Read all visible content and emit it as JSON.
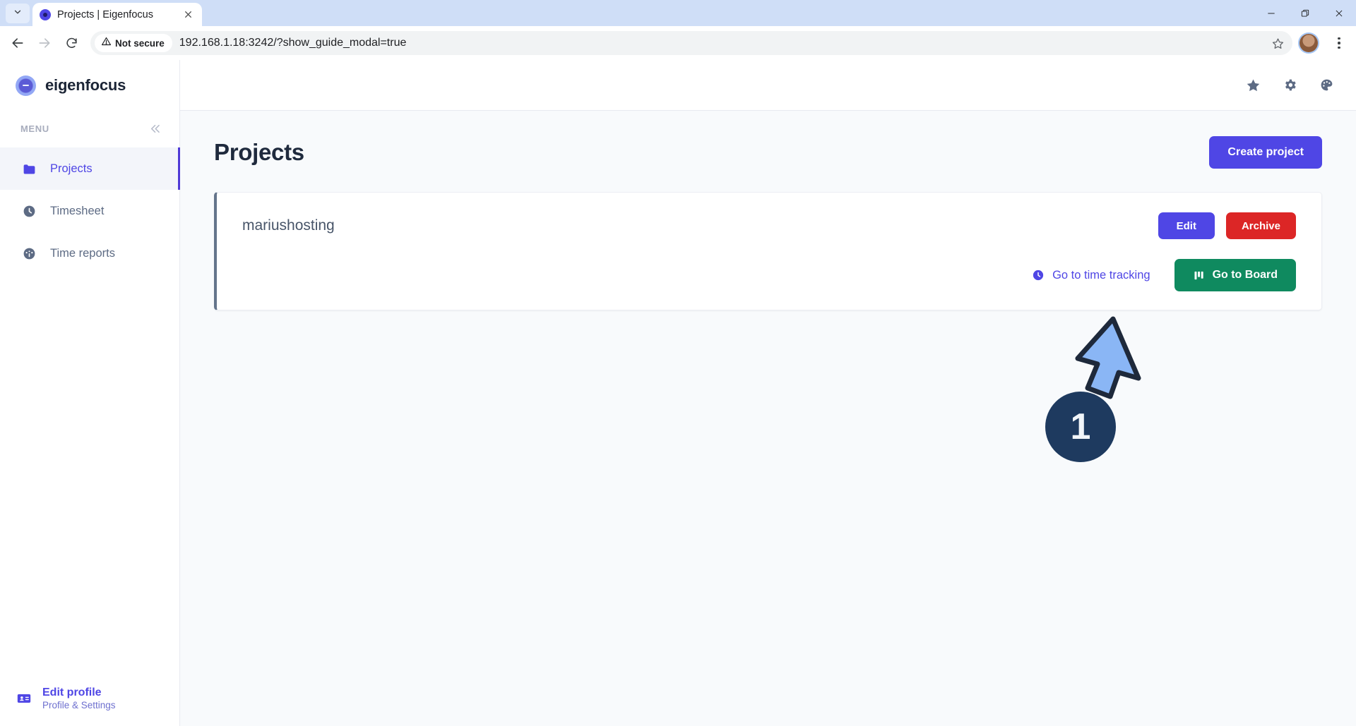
{
  "browser": {
    "tab": {
      "title": "Projects | Eigenfocus",
      "favicon": "circle-dot-icon",
      "close": "close-icon"
    },
    "tabstrip_dropdown_icon": "chevron-down-icon",
    "window_controls": {
      "minimize": "minimize-icon",
      "maximize": "restore-icon",
      "close": "close-icon"
    },
    "nav": {
      "back": "arrow-left-icon",
      "forward": "arrow-right-icon",
      "reload": "reload-icon"
    },
    "omnibox": {
      "security_icon": "warning-triangle-icon",
      "security_label": "Not secure",
      "url": "192.168.1.18:3242/?show_guide_modal=true",
      "bookmark_icon": "star-outline-icon"
    },
    "profile_avatar": "avatar",
    "menu_icon": "kebab-menu-icon"
  },
  "sidebar": {
    "brand": {
      "name": "eigenfocus",
      "logo_icon": "eigenfocus-logo-icon"
    },
    "menu_label": "MENU",
    "collapse_icon": "chevron-double-left-icon",
    "items": [
      {
        "label": "Projects",
        "icon": "folder-icon",
        "active": true
      },
      {
        "label": "Timesheet",
        "icon": "clock-icon",
        "active": false
      },
      {
        "label": "Time reports",
        "icon": "gauge-icon",
        "active": false
      }
    ],
    "footer": {
      "icon": "id-card-icon",
      "title": "Edit profile",
      "subtitle": "Profile & Settings"
    }
  },
  "topbar": {
    "icons": [
      {
        "name": "star-icon"
      },
      {
        "name": "gear-icon"
      },
      {
        "name": "palette-icon"
      }
    ]
  },
  "main": {
    "page_title": "Projects",
    "create_button": "Create project",
    "projects": [
      {
        "name": "mariushosting",
        "edit_label": "Edit",
        "archive_label": "Archive",
        "time_tracking_label": "Go to time tracking",
        "time_tracking_icon": "clock-icon",
        "board_label": "Go to Board",
        "board_icon": "kanban-columns-icon",
        "accent_color": "#64748b"
      }
    ]
  },
  "annotation": {
    "step_number": "1",
    "arrow_icon": "arrow-up-right-icon",
    "badge_color": "#1e3a5f",
    "arrow_fill": "#8ab6f5",
    "arrow_stroke": "#1e293b"
  },
  "colors": {
    "accent": "#4f46e5",
    "danger": "#dc2626",
    "success": "#0f8a5f",
    "sidebar_active_bg": "#f3f5fa",
    "page_bg": "#f8fafc"
  }
}
